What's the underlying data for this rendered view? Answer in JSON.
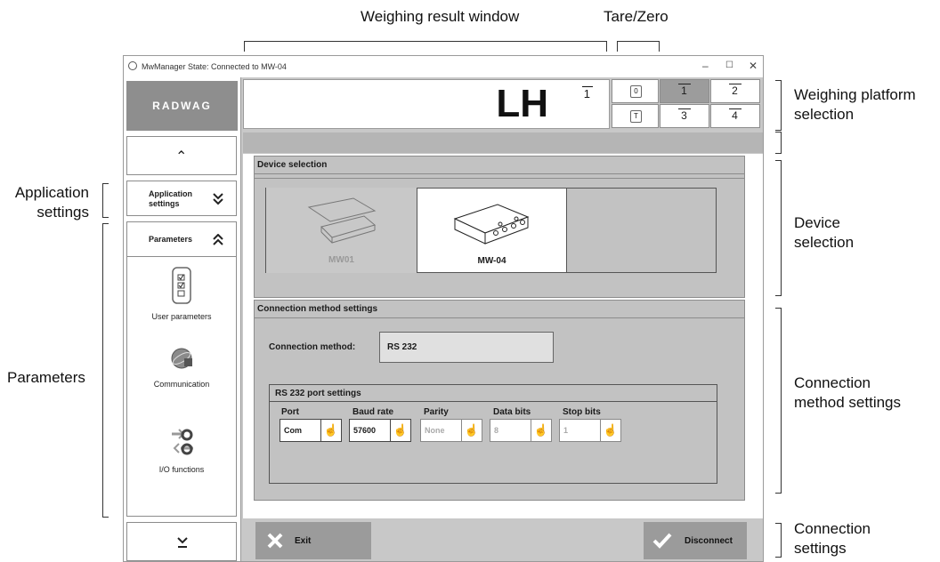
{
  "annotations": {
    "weighing_result_window": "Weighing result window",
    "tare_zero": "Tare/Zero",
    "application_settings_1": "Application",
    "application_settings_2": "settings",
    "parameters": "Parameters",
    "weighing_platform_1": "Weighing platform",
    "weighing_platform_2": "selection",
    "device_selection_1": "Device",
    "device_selection_2": "selection",
    "connection_method_1": "Connection",
    "connection_method_2": "method settings",
    "connection_settings_1": "Connection",
    "connection_settings_2": "settings"
  },
  "window": {
    "title": "MwManager  State: Connected to MW-04",
    "minimize": "–",
    "maximize": "☐",
    "close": "✕"
  },
  "sidebar": {
    "logo": "RADWAG",
    "scroll_up": "⌃",
    "app_settings_label_1": "Application",
    "app_settings_label_2": "settings",
    "app_settings_chev": "≚",
    "parameters_label": "Parameters",
    "parameters_chev": "⌃",
    "items": [
      {
        "label": "User parameters",
        "icon": "checklist-icon"
      },
      {
        "label": "Communication",
        "icon": "communication-icon"
      },
      {
        "label": "I/O functions",
        "icon": "io-arrows-icon"
      }
    ],
    "scroll_down": "⌄"
  },
  "result": {
    "value": "LH",
    "platform": "1"
  },
  "tare_zero": {
    "tare_symbol": "→T←",
    "zero_symbol": "→0←"
  },
  "platforms": [
    "1",
    "2",
    "3",
    "4"
  ],
  "device_section": {
    "title": "Device selection",
    "devices": [
      {
        "name": "MW01",
        "selected": false
      },
      {
        "name": "MW-04",
        "selected": true
      }
    ]
  },
  "connection_section": {
    "title": "Connection method settings",
    "method_label": "Connection method:",
    "method_value": "RS 232",
    "port_settings_title": "RS 232 port settings",
    "columns": [
      "Port",
      "Baud rate",
      "Parity",
      "Data bits",
      "Stop bits"
    ],
    "values": [
      "Com",
      "57600",
      "None",
      "8",
      "1"
    ]
  },
  "footer": {
    "exit_label": "Exit",
    "disconnect_label": "Disconnect"
  },
  "colors": {
    "panel_gray": "#c2c2c2",
    "selected_platform": "#9c9c9c",
    "button_gray": "#9b9b9b"
  }
}
